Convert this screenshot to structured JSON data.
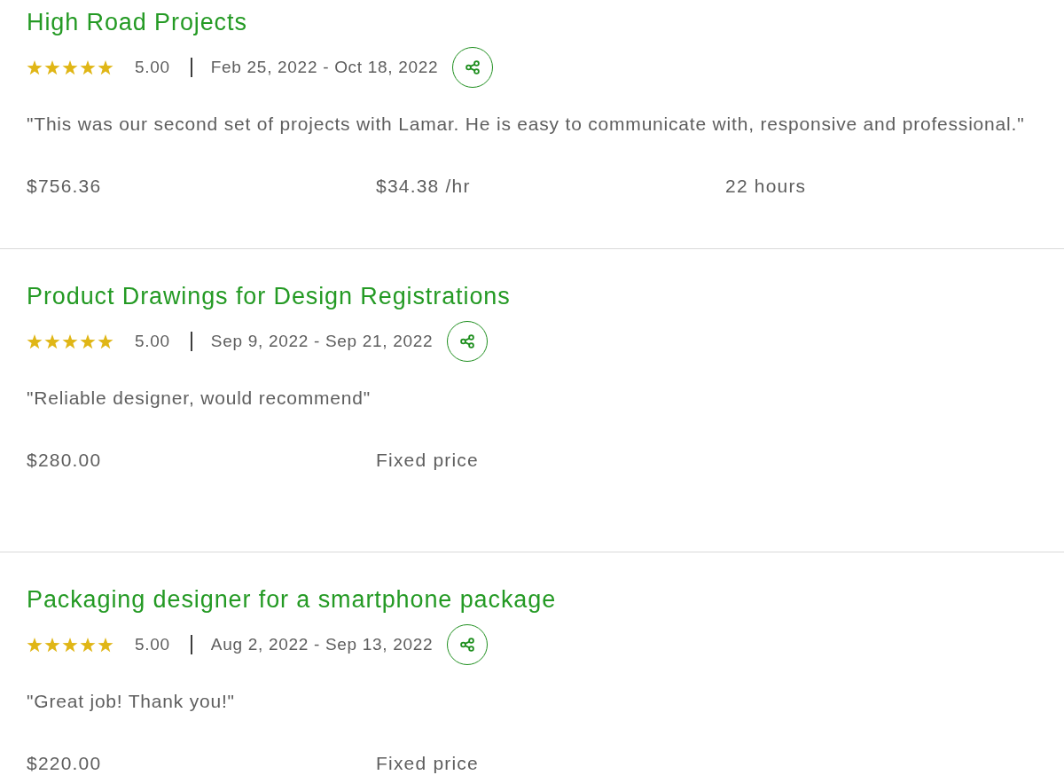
{
  "reviews": [
    {
      "title": "High Road Projects",
      "stars": 5,
      "rating": "5.00",
      "dates": "Feb 25, 2022 - Oct 18, 2022",
      "feedback": "\"This was our second set of projects with Lamar. He is easy to communicate with, responsive and professional.\"",
      "stats": [
        "$756.36",
        "$34.38 /hr",
        "22 hours"
      ]
    },
    {
      "title": "Product Drawings for Design Registrations",
      "stars": 5,
      "rating": "5.00",
      "dates": "Sep 9, 2022 - Sep 21, 2022",
      "feedback": "\"Reliable designer, would recommend\"",
      "stats": [
        "$280.00",
        "Fixed price"
      ]
    },
    {
      "title": "Packaging designer for a smartphone package",
      "stars": 5,
      "rating": "5.00",
      "dates": "Aug 2, 2022 - Sep 13, 2022",
      "feedback": "\"Great job! Thank you!\"",
      "stats": [
        "$220.00",
        "Fixed price"
      ]
    }
  ]
}
